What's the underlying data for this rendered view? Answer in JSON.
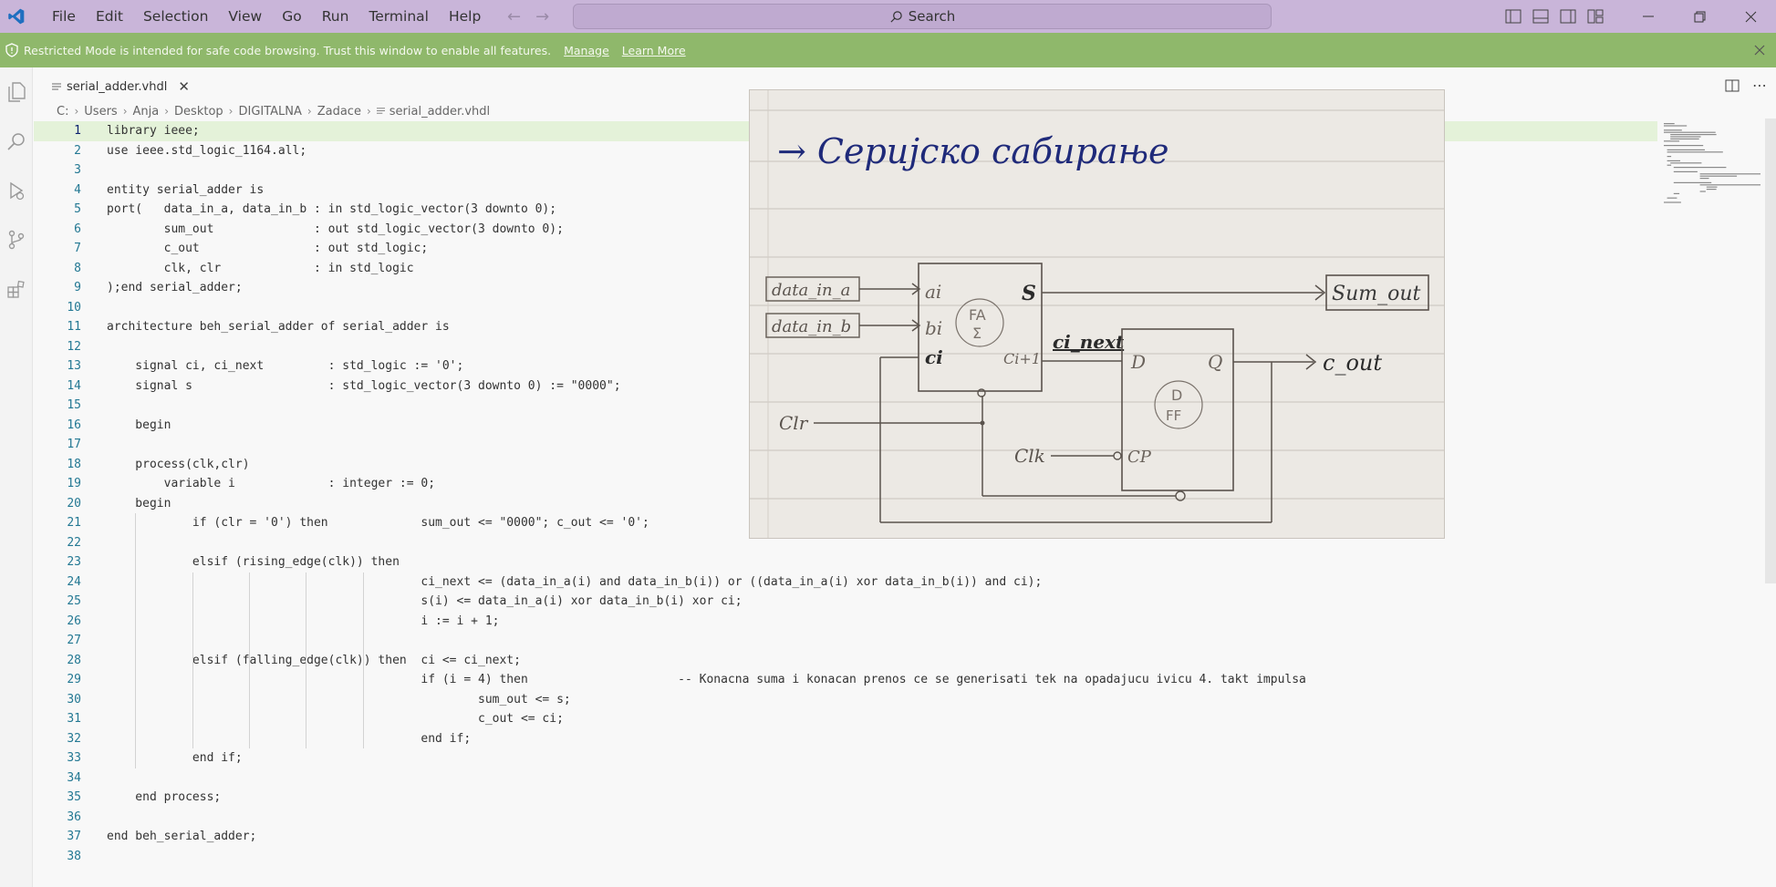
{
  "titlebar": {
    "menu": [
      "File",
      "Edit",
      "Selection",
      "View",
      "Go",
      "Run",
      "Terminal",
      "Help"
    ],
    "search_label": "Search"
  },
  "banner": {
    "message": "Restricted Mode is intended for safe code browsing. Trust this window to enable all features.",
    "manage": "Manage",
    "learn_more": "Learn More"
  },
  "tab": {
    "label": "serial_adder.vhdl"
  },
  "breadcrumb": [
    "C:",
    "Users",
    "Anja",
    "Desktop",
    "DIGITALNA",
    "Zadace",
    "serial_adder.vhdl"
  ],
  "code": {
    "lines": [
      "library ieee;",
      "use ieee.std_logic_1164.all;",
      "",
      "entity serial_adder is",
      "port(   data_in_a, data_in_b : in std_logic_vector(3 downto 0);",
      "        sum_out              : out std_logic_vector(3 downto 0);",
      "        c_out                : out std_logic;",
      "        clk, clr             : in std_logic",
      ");end serial_adder;",
      "",
      "architecture beh_serial_adder of serial_adder is",
      "",
      "    signal ci, ci_next         : std_logic := '0';",
      "    signal s                   : std_logic_vector(3 downto 0) := \"0000\";",
      "",
      "    begin",
      "",
      "    process(clk,clr)",
      "        variable i             : integer := 0;",
      "    begin",
      "            if (clr = '0') then             sum_out <= \"0000\"; c_out <= '0';",
      "",
      "            elsif (rising_edge(clk)) then",
      "                                            ci_next <= (data_in_a(i) and data_in_b(i)) or ((data_in_a(i) xor data_in_b(i)) and ci);",
      "                                            s(i) <= data_in_a(i) xor data_in_b(i) xor ci;",
      "                                            i := i + 1;",
      "",
      "            elsif (falling_edge(clk)) then  ci <= ci_next;",
      "                                            if (i = 4) then                     -- Konacna suma i konacan prenos ce se generisati tek na opadajucu ivicu 4. takt impulsa",
      "                                                    sum_out <= s;",
      "                                                    c_out <= ci;",
      "                                            end if;",
      "            end if;",
      "",
      "    end process;",
      "",
      "end beh_serial_adder;",
      ""
    ]
  },
  "sketch": {
    "title": "→ Серијско сабирање",
    "labels": {
      "in_a": "data_in_a",
      "in_b": "data_in_b",
      "ai": "ai",
      "bi": "bi",
      "ci": "ci",
      "fa": "FA",
      "sigma": "Σ",
      "s": "S",
      "ci1": "Ci+1",
      "ci_next": "ci_next",
      "d": "D",
      "q": "Q",
      "dff1": "D",
      "dff2": "FF",
      "cp": "CP",
      "clr": "Clr",
      "clk": "Clk",
      "sum_out": "Sum_out",
      "c_out": "c_out"
    }
  },
  "colors": {
    "titlebar": "#c9b5d9",
    "banner": "#8fb86b",
    "active_line": "#e4f2d9"
  }
}
